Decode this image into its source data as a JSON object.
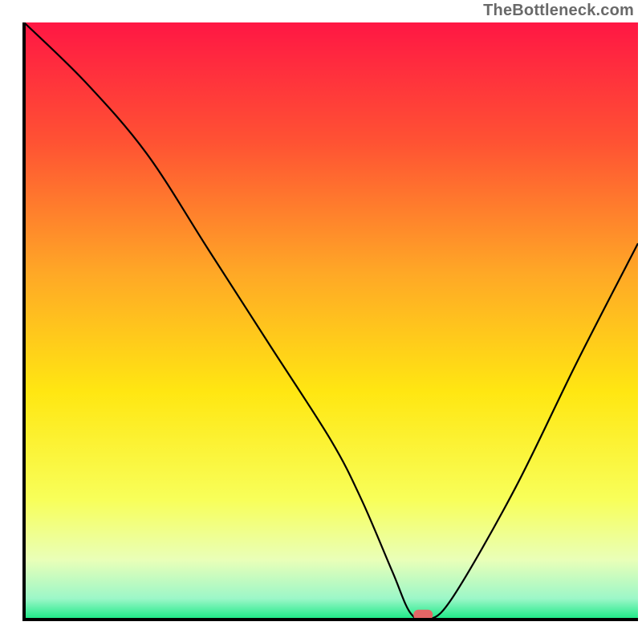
{
  "watermark": "TheBottleneck.com",
  "chart_data": {
    "type": "line",
    "title": "",
    "xlabel": "",
    "ylabel": "",
    "xlim": [
      0,
      100
    ],
    "ylim": [
      0,
      100
    ],
    "x": [
      0,
      10,
      20,
      30,
      40,
      50,
      55,
      60,
      63,
      66,
      70,
      80,
      90,
      100
    ],
    "values": [
      100,
      90,
      78,
      62,
      46,
      30,
      20,
      8,
      1,
      0,
      4,
      22,
      43,
      63
    ],
    "marker": {
      "x": 65,
      "y": 0.5,
      "color": "#e36666"
    },
    "gradient_stops": [
      {
        "offset": 0.0,
        "color": "#ff1744"
      },
      {
        "offset": 0.2,
        "color": "#ff5233"
      },
      {
        "offset": 0.42,
        "color": "#ffa826"
      },
      {
        "offset": 0.62,
        "color": "#ffe712"
      },
      {
        "offset": 0.8,
        "color": "#f8ff5a"
      },
      {
        "offset": 0.9,
        "color": "#e9ffb8"
      },
      {
        "offset": 0.965,
        "color": "#9cf7c8"
      },
      {
        "offset": 1.0,
        "color": "#17e884"
      }
    ],
    "axis_color": "#000000",
    "grid": false,
    "legend": false
  }
}
